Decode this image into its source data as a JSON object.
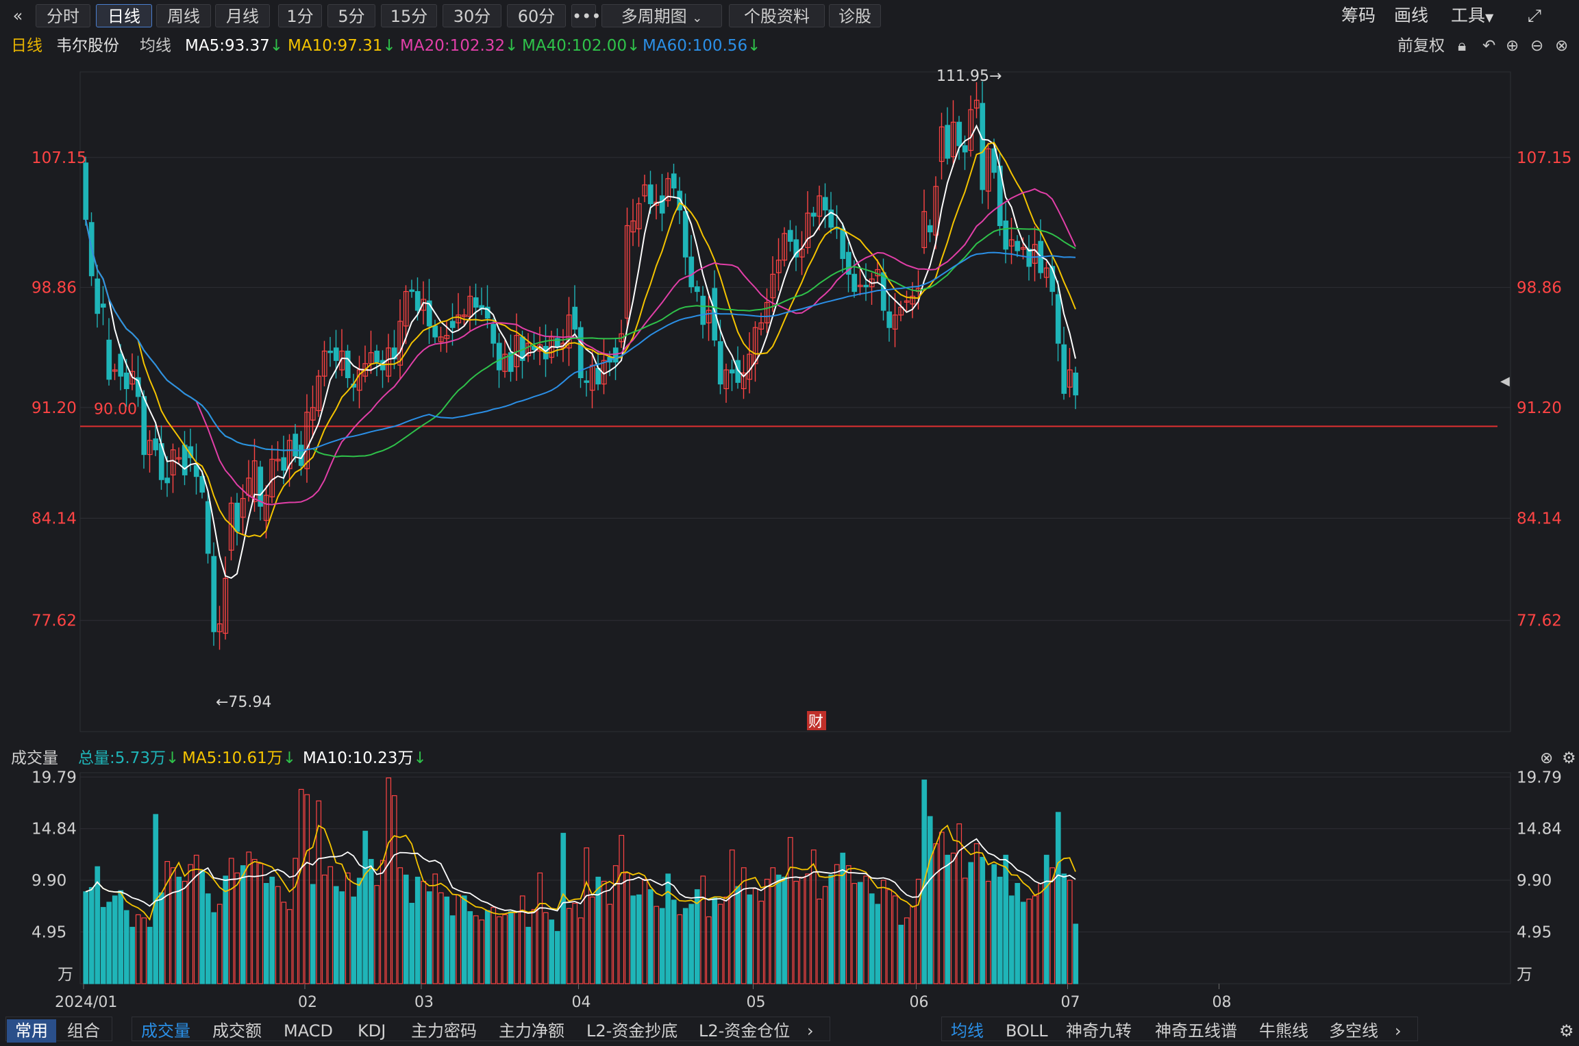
{
  "toolbar": {
    "back_icon": "double-chevron-left",
    "tabs": [
      "分时",
      "日线",
      "周线",
      "月线",
      "1分",
      "5分",
      "15分",
      "30分",
      "60分"
    ],
    "active_tab": "日线",
    "more": "•••",
    "multi": "多周期图",
    "profile": "个股资料",
    "diagnose": "诊股",
    "chips": "筹码",
    "draw": "画线",
    "tools": "工具",
    "fullscreen_icon": "expand-icon"
  },
  "info": {
    "period": "日线",
    "stock": "韦尔股份",
    "ma_label": "均线",
    "ma5": "MA5:93.37",
    "ma10": "MA10:97.31",
    "ma20": "MA20:102.32",
    "ma40": "MA40:102.00",
    "ma60": "MA60:100.56",
    "adjust": "前复权"
  },
  "price_axis": {
    "ticks": [
      "107.15",
      "98.86",
      "91.20",
      "84.14",
      "77.62"
    ],
    "support_label": "90.00",
    "high_label": "111.95→",
    "low_label": "←75.94",
    "event_badge": "财"
  },
  "volume_info": {
    "title": "成交量",
    "total": "总量:5.73万",
    "ma5": "MA5:10.61万",
    "ma10": "MA10:10.23万"
  },
  "volume_axis": {
    "ticks": [
      "19.79",
      "14.84",
      "9.90",
      "4.95"
    ],
    "unit": "万"
  },
  "x_axis": {
    "labels": [
      "2024/01",
      "02",
      "03",
      "04",
      "05",
      "06",
      "07",
      "08"
    ]
  },
  "bottom": {
    "left_tabs": [
      "常用",
      "组合"
    ],
    "indicators": [
      "成交量",
      "成交额",
      "MACD",
      "KDJ",
      "主力密码",
      "主力净额",
      "L2-资金抄底",
      "L2-资金仓位"
    ],
    "overlays": [
      "均线",
      "BOLL",
      "神奇九转",
      "神奇五线谱",
      "牛熊线",
      "多空线"
    ],
    "settings_icon": "gear-icon"
  },
  "colors": {
    "up": "#ff4444",
    "down": "#1fb5b8",
    "ma5": "#ffffff",
    "ma10": "#f5c400",
    "ma20": "#e23fa8",
    "ma40": "#2fc24a",
    "ma60": "#2b8fe6",
    "support": "#e03030"
  },
  "chart_data": {
    "type": "candlestick",
    "xlabel": "",
    "ylabel": "",
    "ylim": [
      73.5,
      111.95
    ],
    "support": 90.0,
    "month_labels": [
      "2024/01",
      "02",
      "03",
      "04",
      "05",
      "06",
      "07",
      "08"
    ],
    "candles": [
      [
        106.8,
        103.2
      ],
      [
        103.0,
        99.6
      ],
      [
        99.4,
        97.2
      ],
      [
        97.8,
        97.6
      ],
      [
        95.5,
        93.0
      ],
      [
        93.6,
        93.6
      ],
      [
        94.6,
        93.2
      ],
      [
        93.4,
        92.4
      ],
      [
        92.7,
        93.5
      ],
      [
        93.1,
        91.9
      ],
      [
        91.9,
        88.2
      ],
      [
        88.2,
        89.1
      ],
      [
        89.2,
        88.5
      ],
      [
        88.9,
        86.6
      ],
      [
        86.7,
        86.4
      ],
      [
        86.9,
        88.5
      ],
      [
        88.0,
        88.0
      ],
      [
        88.8,
        86.9
      ],
      [
        88.7,
        88.0
      ],
      [
        87.5,
        86.8
      ],
      [
        86.8,
        85.8
      ],
      [
        85.2,
        81.9
      ],
      [
        81.7,
        76.9
      ],
      [
        76.9,
        77.4
      ],
      [
        76.8,
        80.3
      ],
      [
        82.1,
        85.1
      ],
      [
        85.1,
        83.3
      ],
      [
        84.2,
        85.4
      ],
      [
        85.6,
        86.7
      ],
      [
        85.2,
        87.8
      ],
      [
        87.4,
        84.9
      ],
      [
        84.0,
        85.6
      ],
      [
        85.5,
        87.9
      ],
      [
        87.8,
        87.9
      ],
      [
        88.0,
        87.2
      ],
      [
        87.3,
        89.1
      ],
      [
        89.5,
        88.1
      ],
      [
        88.8,
        87.5
      ],
      [
        87.3,
        90.9
      ],
      [
        90.4,
        91.2
      ],
      [
        91.0,
        93.2
      ],
      [
        93.2,
        94.8
      ],
      [
        94.8,
        94.7
      ],
      [
        95.0,
        94.2
      ],
      [
        93.6,
        94.8
      ],
      [
        94.8,
        93.1
      ],
      [
        92.7,
        92.5
      ],
      [
        92.3,
        93.6
      ],
      [
        93.2,
        94.0
      ],
      [
        94.0,
        94.7
      ],
      [
        94.8,
        94.1
      ],
      [
        94.2,
        93.6
      ],
      [
        93.2,
        95.0
      ],
      [
        95.0,
        94.3
      ],
      [
        93.9,
        96.7
      ],
      [
        96.4,
        98.6
      ],
      [
        98.7,
        98.6
      ],
      [
        98.6,
        97.4
      ],
      [
        97.4,
        98.1
      ],
      [
        98.0,
        96.4
      ],
      [
        96.4,
        95.7
      ],
      [
        95.4,
        95.7
      ],
      [
        95.6,
        95.8
      ],
      [
        96.7,
        96.3
      ],
      [
        96.6,
        97.1
      ],
      [
        97.0,
        97.1
      ],
      [
        97.0,
        98.3
      ],
      [
        98.2,
        97.6
      ],
      [
        97.7,
        97.5
      ],
      [
        97.6,
        96.9
      ],
      [
        96.5,
        95.3
      ],
      [
        95.3,
        93.6
      ],
      [
        93.5,
        94.6
      ],
      [
        94.7,
        93.5
      ],
      [
        93.8,
        95.8
      ],
      [
        95.7,
        94.2
      ],
      [
        94.5,
        95.3
      ],
      [
        95.1,
        94.9
      ],
      [
        94.8,
        95.2
      ],
      [
        95.1,
        94.3
      ],
      [
        94.4,
        95.7
      ],
      [
        95.6,
        95.1
      ],
      [
        95.0,
        95.3
      ],
      [
        95.0,
        97.1
      ],
      [
        97.6,
        96.2
      ],
      [
        96.3,
        93.1
      ],
      [
        92.9,
        92.8
      ],
      [
        92.3,
        93.9
      ],
      [
        93.7,
        92.7
      ],
      [
        92.7,
        94.2
      ],
      [
        94.4,
        94.1
      ],
      [
        95.0,
        94.1
      ],
      [
        95.4,
        95.9
      ],
      [
        96.9,
        102.8
      ],
      [
        102.4,
        103.1
      ],
      [
        102.6,
        104.2
      ],
      [
        104.7,
        105.4
      ],
      [
        105.4,
        104.2
      ],
      [
        104.1,
        104.3
      ],
      [
        104.7,
        103.6
      ],
      [
        104.4,
        105.8
      ],
      [
        106.1,
        105.2
      ],
      [
        105.0,
        103.8
      ],
      [
        103.7,
        100.8
      ],
      [
        100.8,
        98.9
      ],
      [
        98.9,
        98.6
      ],
      [
        98.3,
        96.5
      ],
      [
        96.6,
        97.4
      ],
      [
        98.8,
        95.5
      ],
      [
        95.4,
        92.7
      ],
      [
        92.4,
        93.6
      ],
      [
        93.6,
        93.4
      ],
      [
        94.2,
        92.8
      ],
      [
        92.4,
        93.4
      ],
      [
        93.0,
        94.6
      ],
      [
        94.0,
        96.3
      ],
      [
        96.2,
        96.6
      ],
      [
        96.6,
        97.9
      ],
      [
        98.2,
        99.7
      ],
      [
        99.8,
        100.6
      ],
      [
        100.6,
        102.3
      ],
      [
        102.5,
        101.8
      ],
      [
        101.9,
        100.8
      ],
      [
        100.8,
        101.3
      ],
      [
        101.4,
        103.6
      ],
      [
        103.6,
        103.4
      ],
      [
        103.4,
        104.7
      ],
      [
        104.6,
        103.8
      ],
      [
        103.8,
        102.7
      ],
      [
        102.7,
        102.6
      ],
      [
        102.6,
        100.7
      ],
      [
        101.1,
        99.7
      ],
      [
        99.7,
        98.6
      ],
      [
        99.0,
        99.0
      ],
      [
        99.0,
        98.9
      ],
      [
        98.9,
        99.4
      ],
      [
        99.6,
        100.0
      ],
      [
        99.8,
        97.4
      ],
      [
        97.3,
        96.3
      ],
      [
        96.2,
        97.1
      ],
      [
        97.1,
        97.6
      ],
      [
        98.0,
        98.0
      ],
      [
        97.8,
        98.3
      ],
      [
        98.6,
        98.8
      ],
      [
        101.4,
        103.7
      ],
      [
        102.8,
        102.4
      ],
      [
        102.2,
        105.3
      ],
      [
        106.9,
        109.1
      ],
      [
        109.2,
        107.1
      ],
      [
        107.2,
        109.4
      ],
      [
        109.4,
        107.9
      ],
      [
        107.9,
        107.5
      ],
      [
        107.6,
        110.2
      ],
      [
        110.3,
        110.8
      ],
      [
        110.6,
        105.1
      ],
      [
        105.0,
        107.7
      ],
      [
        107.7,
        106.2
      ],
      [
        106.6,
        102.8
      ],
      [
        103.1,
        101.3
      ],
      [
        101.5,
        101.9
      ],
      [
        101.8,
        101.2
      ],
      [
        101.3,
        101.4
      ],
      [
        101.3,
        100.2
      ],
      [
        100.4,
        101.6
      ],
      [
        101.8,
        99.8
      ],
      [
        99.5,
        100.1
      ],
      [
        100.2,
        98.6
      ],
      [
        98.4,
        95.3
      ],
      [
        95.2,
        92.1
      ],
      [
        92.5,
        93.6
      ],
      [
        93.4,
        92.0
      ]
    ],
    "volumes": [
      [
        8.8,
        0
      ],
      [
        9.2,
        0
      ],
      [
        11.2,
        0
      ],
      [
        7.3,
        0
      ],
      [
        7.8,
        0
      ],
      [
        8.4,
        0
      ],
      [
        8.9,
        0
      ],
      [
        7.0,
        0
      ],
      [
        5.4,
        0
      ],
      [
        6.6,
        1
      ],
      [
        6.3,
        1
      ],
      [
        5.4,
        0
      ],
      [
        16.2,
        0
      ],
      [
        8.7,
        0
      ],
      [
        11.7,
        1
      ],
      [
        11.1,
        1
      ],
      [
        10.2,
        0
      ],
      [
        9.8,
        1
      ],
      [
        11.4,
        1
      ],
      [
        12.3,
        1
      ],
      [
        10.8,
        0
      ],
      [
        8.6,
        0
      ],
      [
        6.8,
        0
      ],
      [
        7.6,
        1
      ],
      [
        10.3,
        0
      ],
      [
        12.0,
        1
      ],
      [
        10.6,
        1
      ],
      [
        11.3,
        0
      ],
      [
        12.6,
        1
      ],
      [
        11.9,
        1
      ],
      [
        11.5,
        1
      ],
      [
        9.6,
        0
      ],
      [
        10.2,
        0
      ],
      [
        9.3,
        1
      ],
      [
        7.8,
        1
      ],
      [
        7.1,
        1
      ],
      [
        12.0,
        1
      ],
      [
        18.6,
        1
      ],
      [
        18.1,
        1
      ],
      [
        9.5,
        0
      ],
      [
        17.5,
        1
      ],
      [
        10.4,
        1
      ],
      [
        11.2,
        1
      ],
      [
        9.3,
        0
      ],
      [
        8.8,
        0
      ],
      [
        10.6,
        1
      ],
      [
        8.3,
        0
      ],
      [
        10.1,
        0
      ],
      [
        14.6,
        0
      ],
      [
        11.9,
        0
      ],
      [
        9.4,
        1
      ],
      [
        11.8,
        1
      ],
      [
        19.7,
        1
      ],
      [
        18.0,
        1
      ],
      [
        11.1,
        1
      ],
      [
        10.4,
        0
      ],
      [
        7.7,
        0
      ],
      [
        10.2,
        0
      ],
      [
        9.8,
        1
      ],
      [
        8.8,
        0
      ],
      [
        10.5,
        1
      ],
      [
        8.7,
        1
      ],
      [
        8.3,
        0
      ],
      [
        6.5,
        0
      ],
      [
        8.5,
        1
      ],
      [
        8.4,
        0
      ],
      [
        6.9,
        0
      ],
      [
        6.5,
        1
      ],
      [
        6.1,
        1
      ],
      [
        7.0,
        0
      ],
      [
        7.3,
        1
      ],
      [
        6.4,
        1
      ],
      [
        6.6,
        1
      ],
      [
        6.9,
        0
      ],
      [
        6.9,
        1
      ],
      [
        8.4,
        1
      ],
      [
        5.4,
        0
      ],
      [
        7.1,
        1
      ],
      [
        10.6,
        1
      ],
      [
        6.8,
        1
      ],
      [
        6.1,
        0
      ],
      [
        5.0,
        0
      ],
      [
        14.4,
        0
      ],
      [
        7.2,
        1
      ],
      [
        7.7,
        1
      ],
      [
        6.3,
        1
      ],
      [
        13.0,
        1
      ],
      [
        8.3,
        1
      ],
      [
        10.2,
        0
      ],
      [
        9.8,
        1
      ],
      [
        7.6,
        1
      ],
      [
        11.3,
        1
      ],
      [
        14.2,
        1
      ],
      [
        10.6,
        1
      ],
      [
        8.4,
        0
      ],
      [
        8.5,
        0
      ],
      [
        10.0,
        1
      ],
      [
        9.0,
        0
      ],
      [
        7.4,
        1
      ],
      [
        7.2,
        0
      ],
      [
        10.5,
        0
      ],
      [
        8.0,
        0
      ],
      [
        6.6,
        1
      ],
      [
        7.2,
        0
      ],
      [
        7.6,
        0
      ],
      [
        9.0,
        0
      ],
      [
        10.3,
        1
      ],
      [
        6.4,
        1
      ],
      [
        8.2,
        0
      ],
      [
        7.6,
        1
      ],
      [
        8.3,
        1
      ],
      [
        12.8,
        1
      ],
      [
        9.3,
        0
      ],
      [
        11.1,
        1
      ],
      [
        8.5,
        0
      ],
      [
        9.1,
        1
      ],
      [
        7.9,
        1
      ],
      [
        10.0,
        1
      ],
      [
        11.1,
        1
      ],
      [
        10.4,
        0
      ],
      [
        10.2,
        0
      ],
      [
        14.0,
        1
      ],
      [
        9.8,
        1
      ],
      [
        10.2,
        1
      ],
      [
        10.5,
        1
      ],
      [
        12.8,
        1
      ],
      [
        8.1,
        1
      ],
      [
        9.3,
        1
      ],
      [
        10.4,
        0
      ],
      [
        11.4,
        1
      ],
      [
        12.5,
        0
      ],
      [
        11.3,
        1
      ],
      [
        9.6,
        1
      ],
      [
        9.7,
        0
      ],
      [
        10.3,
        1
      ],
      [
        8.6,
        0
      ],
      [
        7.6,
        0
      ],
      [
        9.9,
        1
      ],
      [
        9.0,
        1
      ],
      [
        8.4,
        1
      ],
      [
        5.6,
        0
      ],
      [
        6.3,
        1
      ],
      [
        7.4,
        1
      ],
      [
        10.0,
        1
      ],
      [
        19.5,
        0
      ],
      [
        16.0,
        0
      ],
      [
        13.4,
        1
      ],
      [
        14.5,
        1
      ],
      [
        12.3,
        0
      ],
      [
        12.5,
        1
      ],
      [
        15.3,
        1
      ],
      [
        10.1,
        1
      ],
      [
        11.6,
        0
      ],
      [
        13.4,
        1
      ],
      [
        12.1,
        0
      ],
      [
        9.8,
        1
      ],
      [
        11.4,
        0
      ],
      [
        10.2,
        0
      ],
      [
        12.3,
        0
      ],
      [
        8.4,
        0
      ],
      [
        9.6,
        0
      ],
      [
        7.8,
        0
      ],
      [
        8.1,
        1
      ],
      [
        8.4,
        1
      ],
      [
        9.6,
        1
      ],
      [
        12.3,
        0
      ],
      [
        11.1,
        1
      ],
      [
        16.4,
        0
      ],
      [
        10.5,
        0
      ],
      [
        9.9,
        1
      ],
      [
        5.7,
        0
      ]
    ]
  }
}
